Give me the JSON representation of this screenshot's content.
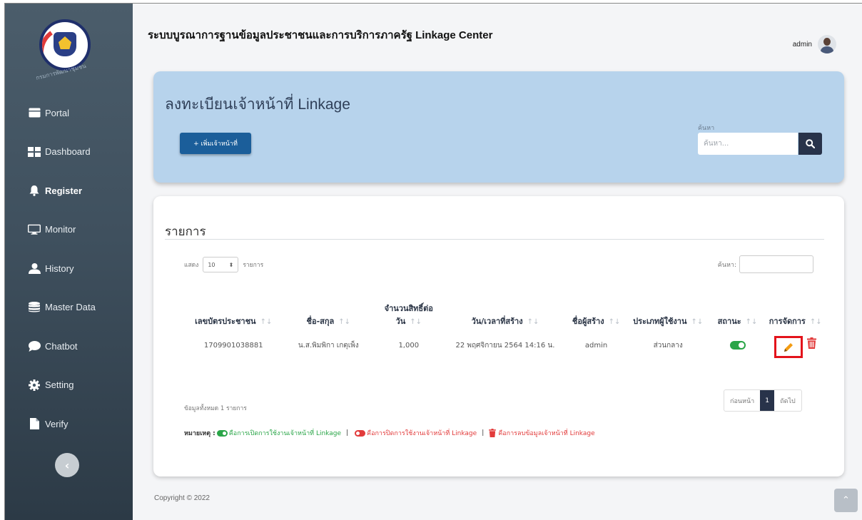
{
  "app": {
    "title": "ระบบบูรณาการฐานข้อมูลประชาชนและการบริการภาครัฐ Linkage Center"
  },
  "user": {
    "name": "admin"
  },
  "logo": {
    "caption": "กรมการพัฒนาชุมชน"
  },
  "sidebar": {
    "items": [
      {
        "label": "Portal",
        "icon": "portal-icon"
      },
      {
        "label": "Dashboard",
        "icon": "dashboard-icon"
      },
      {
        "label": "Register",
        "icon": "bell-icon",
        "active": true
      },
      {
        "label": "Monitor",
        "icon": "monitor-icon"
      },
      {
        "label": "History",
        "icon": "user-icon"
      },
      {
        "label": "Master Data",
        "icon": "database-icon"
      },
      {
        "label": "Chatbot",
        "icon": "chat-icon"
      },
      {
        "label": "Setting",
        "icon": "gear-icon"
      },
      {
        "label": "Verify",
        "icon": "file-icon"
      }
    ],
    "collapse_icon": "chevron-left-icon"
  },
  "hero": {
    "title": "ลงทะเบียนเจ้าหน้าที่ Linkage",
    "add_button": "+ เพิ่มเจ้าหน้าที่",
    "search_label": "ค้นหา",
    "search_placeholder": "ค้นหา..."
  },
  "list": {
    "title": "รายการ",
    "show_prefix": "แสดง",
    "show_value": "10",
    "show_suffix": "รายการ",
    "filter_label": "ค้นหา:",
    "columns": [
      "เลขบัตรประชาชน",
      "ชื่อ-สกุล",
      "จำนวนสิทธิ์ต่อวัน",
      "วัน/เวลาที่สร้าง",
      "ชื่อผู้สร้าง",
      "ประเภทผู้ใช้งาน",
      "สถานะ",
      "การจัดการ"
    ],
    "column_first_line": "จำนวนสิทธิ์ต่อ",
    "column_second_line": "วัน",
    "rows": [
      {
        "id_card": "1709901038881",
        "name": "น.ส.พิมพิกา เกตุเพ็ง",
        "quota": "1,000",
        "created": "22 พฤศจิกายน 2564 14:16 น.",
        "creator": "admin",
        "user_type": "ส่วนกลาง",
        "status": "enabled"
      }
    ],
    "info": "ข้อมูลทั้งหมด 1 รายการ",
    "pager": {
      "prev": "ก่อนหน้า",
      "current": "1",
      "next": "ถัดไป"
    },
    "legend": {
      "prefix": "หมายเหตุ :",
      "on_text": "คือการเปิดการใช้งานเจ้าหน้าที่ Linkage",
      "off_text": "คือการปิดการใช้งานเจ้าหน้าที่ Linkage",
      "delete_text": "คือการลบข้อมูลเจ้าหน้าที่ Linkage",
      "separator": "|"
    }
  },
  "footer": {
    "copyright": "Copyright © 2022"
  },
  "colors": {
    "sidebar": "#3f505e",
    "hero": "#b7d3ec",
    "primary": "#1b5e9a",
    "dark": "#28334a",
    "green": "#2aa548",
    "red": "#e23b3b",
    "edit": "#f39c12"
  }
}
